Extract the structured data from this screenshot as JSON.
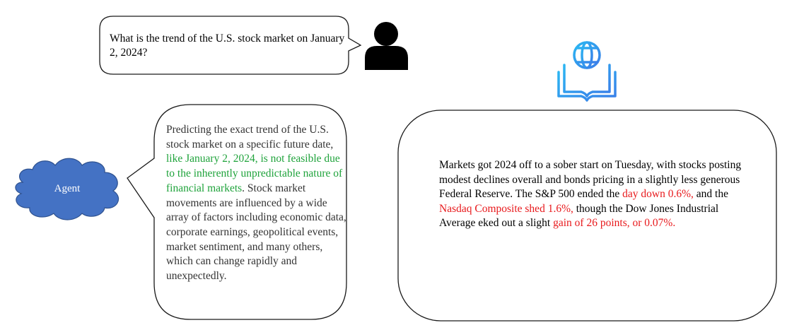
{
  "user_question": "What is the trend of the U.S. stock market on January 2, 2024?",
  "agent": {
    "label": "Agent",
    "response_plain_1": "Predicting the exact trend of the U.S. stock market on a specific future date, ",
    "response_highlight": "like January 2, 2024, is not feasible due to the inherently unpredictable nature of financial markets",
    "response_plain_2": ". Stock market movements are influenced by a wide array of factors including economic data, corporate earnings, geopolitical events, market sentiment, and many others, which can change rapidly and unexpectedly."
  },
  "news": {
    "plain_1": "Markets got 2024 off to a sober start on Tuesday, with stocks posting modest declines overall and bonds pricing in a slightly less generous Federal Reserve. The S&P 500 ended the ",
    "red_1": "day down 0.6%,",
    "plain_2": " and the ",
    "red_2": "Nasdaq Composite shed 1.6%,",
    "plain_3": " though the Dow Jones Industrial Average eked out a slight ",
    "red_3": "gain of 26 points, or 0.07%."
  },
  "icons": {
    "user": "user-icon",
    "knowledge": "globe-book-icon"
  },
  "colors": {
    "highlight_green": "#1fa33b",
    "highlight_red": "#e8191c",
    "cloud_fill": "#4472c4",
    "icon_blue": "#3aa0f0"
  }
}
